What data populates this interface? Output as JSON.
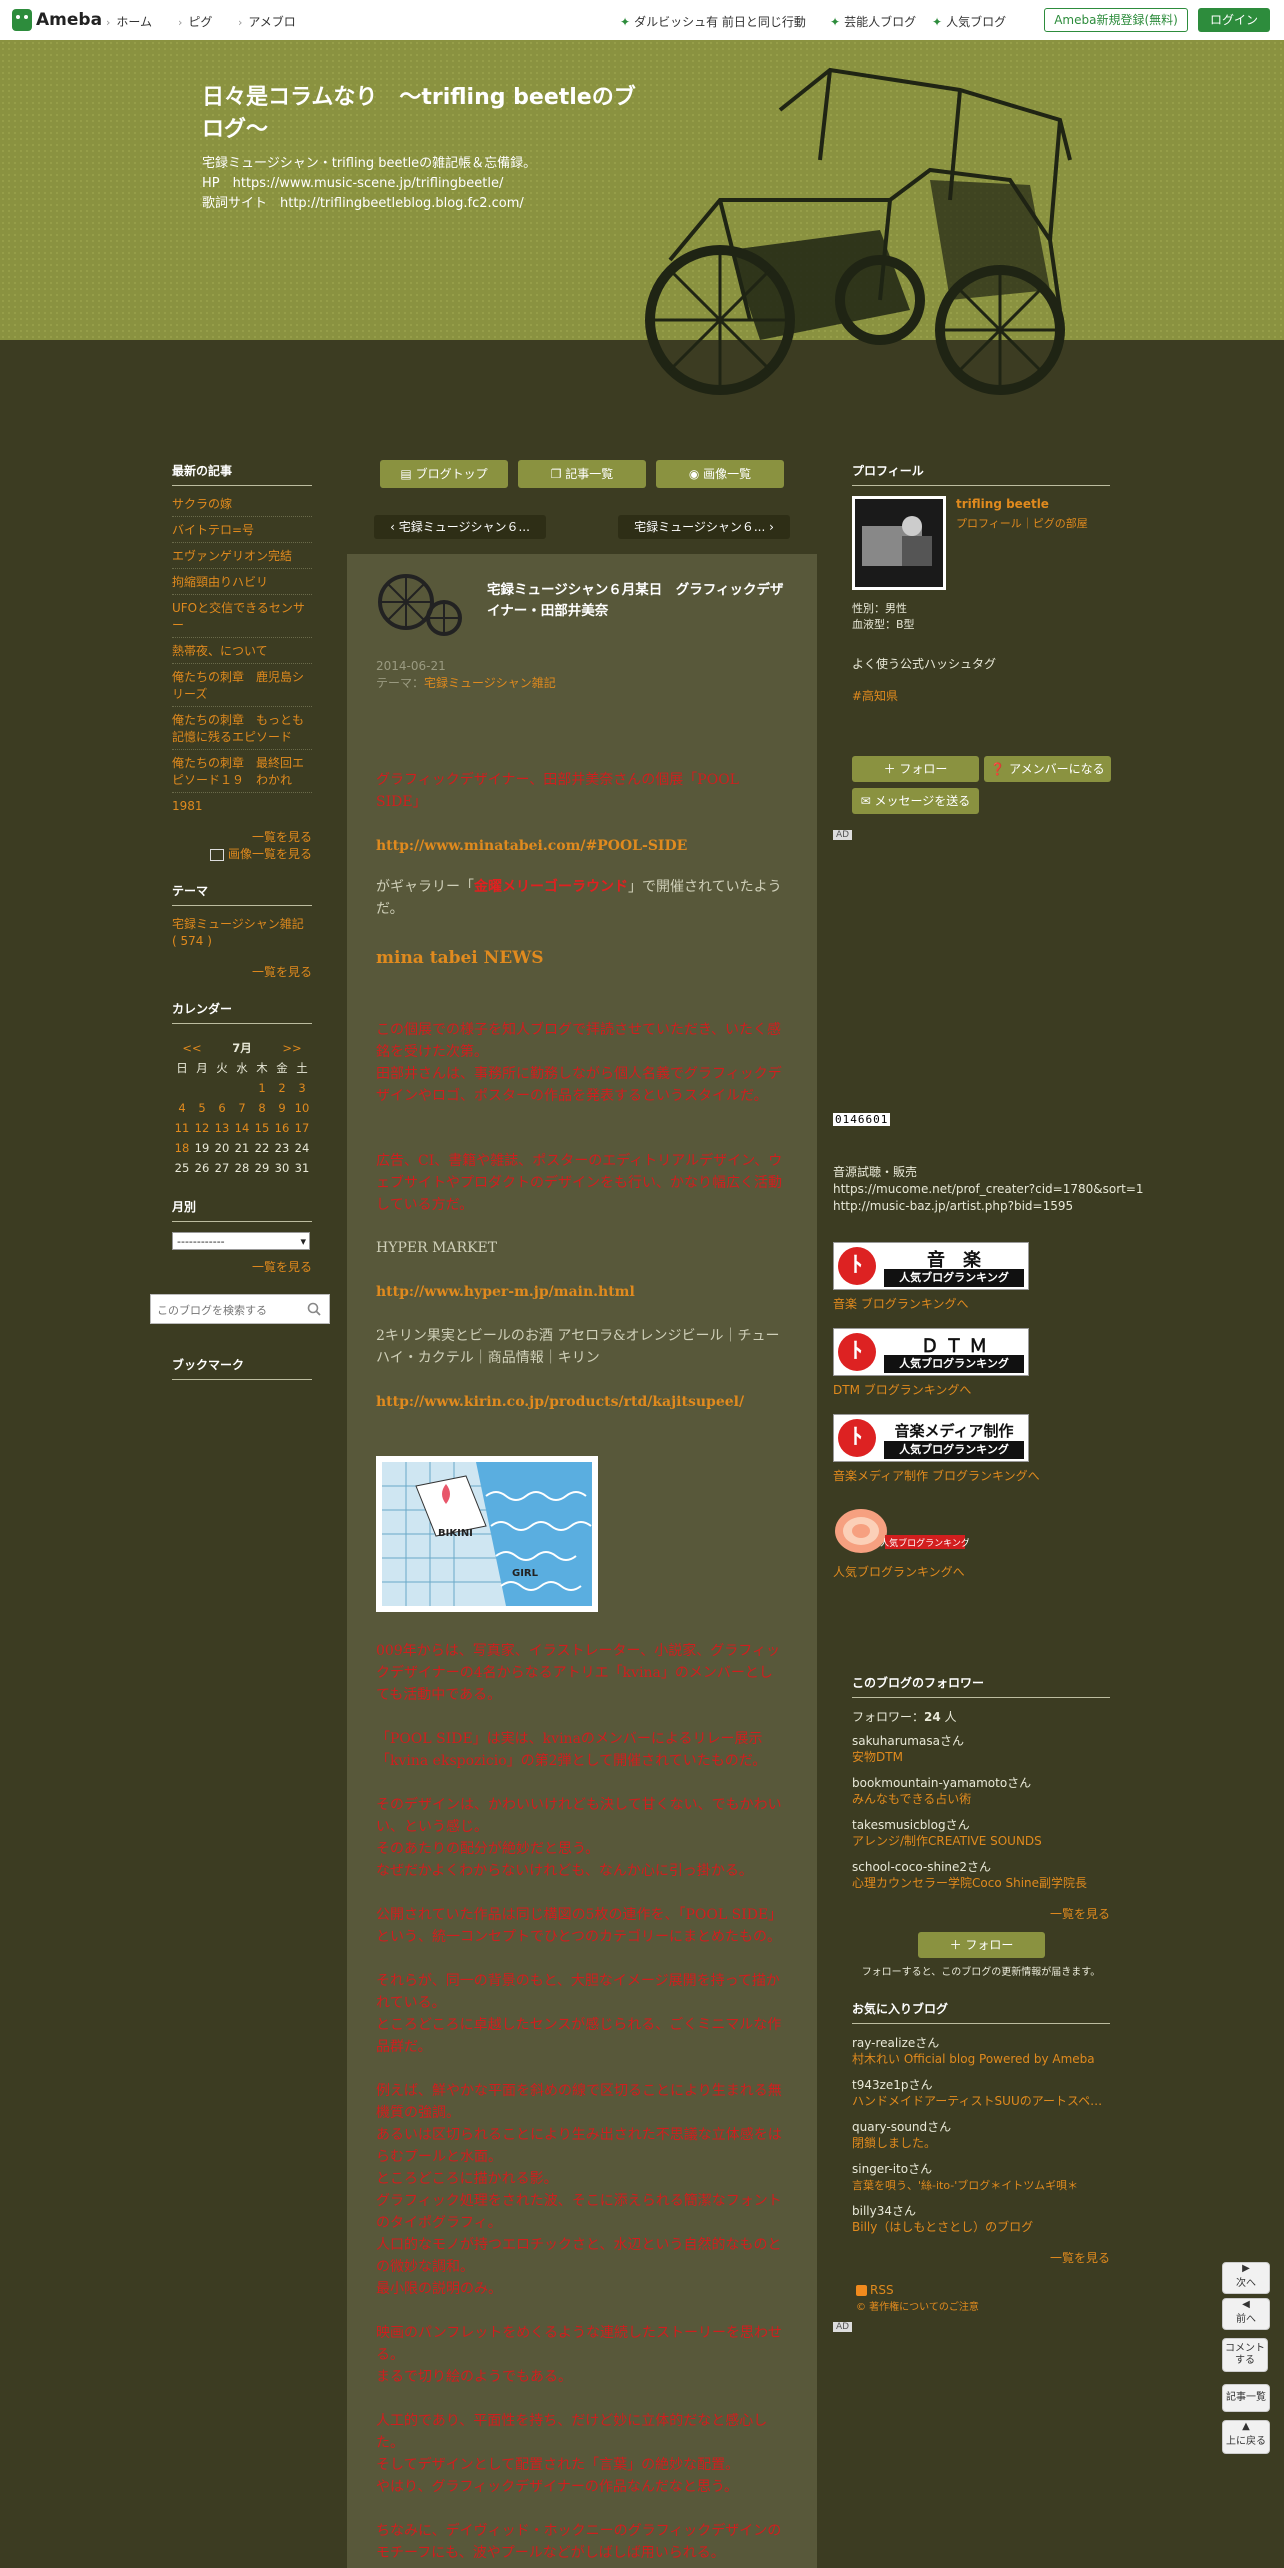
{
  "topbar": {
    "logo": "Ameba",
    "nav": [
      "ホーム",
      "ピグ",
      "アメブロ"
    ],
    "right_links": [
      "ダルビッシュ有 前日と同じ行動",
      "芸能人ブログ",
      "人気ブログ"
    ],
    "register": "Ameba新規登録(無料)",
    "login": "ログイン"
  },
  "header": {
    "title": "日々是コラムなり　～trifling beetleのブログ～",
    "desc": [
      "宅録ミュージシャン・trifling beetleの雑記帳＆忘備録。",
      "HP　https://www.music-scene.jp/triflingbeetle/",
      "歌詞サイト　http://triflingbeetleblog.blog.fc2.com/"
    ]
  },
  "left": {
    "recent_heading": "最新の記事",
    "recent": [
      "サクラの嫁",
      "バイトテロ=号",
      "エヴァンゲリオン完結",
      "拘縮頸由りハビリ",
      "UFOと交信できるセンサー",
      "熱帯夜、について",
      "俺たちの刺章　鹿児島シリーズ",
      "俺たちの刺章　もっとも記憶に残るエピソード",
      "俺たちの刺章　最終回エピソード１９　わかれ",
      "1981"
    ],
    "see_all": "一覧を見る",
    "image_list": "画像一覧を見る",
    "theme_heading": "テーマ",
    "theme": "宅録ミュージシャン雑記 ( 574 )",
    "theme_see_all": "一覧を見る",
    "calendar_heading": "カレンダー",
    "calendar": {
      "prev": "<<",
      "month": "7月",
      "next": ">>",
      "days": [
        "日",
        "月",
        "火",
        "水",
        "木",
        "金",
        "土"
      ],
      "rows": [
        [
          "",
          "",
          "",
          "",
          "",
          "1",
          "2",
          "3"
        ],
        [
          "4",
          "5",
          "6",
          "7",
          "8",
          "9",
          "10"
        ],
        [
          "11",
          "12",
          "13",
          "14",
          "15",
          "16",
          "17"
        ],
        [
          "18",
          "19",
          "20",
          "21",
          "22",
          "23",
          "24"
        ],
        [
          "25",
          "26",
          "27",
          "28",
          "29",
          "30",
          "31"
        ]
      ]
    },
    "month_heading": "月別",
    "month_select": "------------",
    "month_see_all": "一覧を見る",
    "search_placeholder": "このブログを検索する",
    "bookmark_heading": "ブックマーク"
  },
  "main": {
    "buttons": [
      "ブログトップ",
      "記事一覧",
      "画像一覧"
    ],
    "prev_post": "宅録ミュージシャン６...",
    "next_post": "宅録ミュージシャン６...",
    "title": "宅録ミュージシャン６月某日　グラフィックデザイナー・田部井美奈",
    "date": "2014-06-21",
    "theme_label": "テーマ：",
    "theme": "宅録ミュージシャン雑記",
    "p1": "グラフィックデザイナー、田部井美奈さんの個展「POOL SIDE」",
    "link1": "http://www.minatabei.com/#POOL-SIDE",
    "p2a": "がギャラリー「",
    "p2link": "金曜メリーゴーラウンド",
    "p2b": "」で開催されていたようだ。",
    "news": "mina tabei NEWS",
    "p3": [
      "この個展での様子を知人ブログで拝読させていただき、いたく感銘を受けた次第。",
      "田部井さんは、事務所に勤務しながら個人名義でグラフィックデザインやロゴ、ポスターの作品を発表するというスタイルだ。"
    ],
    "p4": "広告、CI、書籍や雑誌、ポスターのエディトリアルデザイン、ウェブサイトやプロダクトのデザインをも行い、かなり幅広く活動している方だ。",
    "hyper": "HYPER MARKET",
    "link2": "http://www.hyper-m.jp/main.html",
    "kirin": "2キリン果実とビールのお酒 アセロラ&オレンジビール｜チューハイ・カクテル｜商品情報｜キリン",
    "link3": "http://www.kirin.co.jp/products/rtd/kajitsupeel/",
    "img_text1": "BIKINI",
    "img_text2": "GIRL",
    "p5": "009年からは、写真家、イラストレーター、小説家、グラフィックデザイナーの4名からなるアトリエ「kvina」のメンバーとしても活動中である。",
    "p6": "「POOL SIDE」は実は、kvinaのメンバーによるリレー展示「kvina ekspozicio」の第2弾として開催されていたものだ。",
    "p7": [
      "そのデザインは、かわいいけれども決して甘くない、でもかわいい、という感じ。",
      "そのあたりの配分が絶妙だと思う。",
      "なぜだかよくわからないけれども、なんか心に引っ掛かる。"
    ],
    "p8": [
      "公開されていた作品は同じ構図の5枚の連作を、「POOL SIDE」という、統一コンセプトでひとつのカテゴリーにまとめたもの。",
      "それらが、同一の背景のもと、大胆なイメージ展開を持って描かれている。",
      "ところどころに卓越したセンスが感じられる、ごくミニマルな作品群だ。"
    ],
    "p9": [
      "例えば、鮮やかな平面を斜めの線で区切ることにより生まれる無機質の強調。",
      "あるいは区切られることにより生み出された不思議な立体感をはらむプールと水面。",
      "ところどころに描かれる影。",
      "グラフィック処理をされた波、そこに添えられる簡潔なフォントのタイポグラフィ。",
      "人口的なモノが持つエロチックさと、水辺という自然的なものとの微妙な調和。",
      "最小限の説明のみ。"
    ],
    "p10": [
      "映画のパンフレットをめくるような連続したストーリーを思わせる。",
      "まるで切り絵のようでもある。"
    ],
    "p11": [
      "人工的であり、平面性を持ち、だけど妙に立体的だなと感心した。",
      "そしてデザインとして配置された「言葉」の絶妙な配置。",
      "やはり、グラフィックデザイナーの作品なんだなと思う。"
    ],
    "p12": "ちなみに、デイヴィッド・ホックニーのグラフィックデザインのモチーフにも、波やプールなどがしばしば用いられる。"
  },
  "right": {
    "profile_heading": "プロフィール",
    "name": "trifling beetle",
    "profile_links": "プロフィール｜ピグの部屋",
    "gender": "性別：男性",
    "blood": "血液型：B型",
    "hashtag_heading": "よく使う公式ハッシュタグ",
    "hashtag": "#高知県",
    "follow": "フォロー",
    "member": "アメンバーになる",
    "message": "メッセージを送る",
    "ad": "AD",
    "counter": "0146601",
    "music_text": [
      "音源試聴・販売",
      "https://mucome.net/prof_creater?cid=1780&sort=1",
      "http://music-baz.jp/artist.php?bid=1595"
    ],
    "rank1_big": "音　楽",
    "rank1_small": "人気ブログランキング",
    "rank1_link": "音楽 ブログランキングへ",
    "rank2_big": "Ｄ Ｔ Ｍ",
    "rank2_small": "人気ブログランキング",
    "rank2_link": "DTM ブログランキングへ",
    "rank3_big": "音楽メディア制作",
    "rank3_small": "人気ブログランキング",
    "rank3_link": "音楽メディア制作 ブログランキングへ",
    "rank4_label": "人気ブログランキング",
    "rank4_link": "人気ブログランキングへ",
    "followers_heading": "このブログのフォロワー",
    "followers_label": "フォロワー：",
    "followers_count": "24",
    "followers_unit": "人",
    "followers": [
      {
        "name": "sakuharumasaさん",
        "blog": "安物DTM"
      },
      {
        "name": "bookmountain-yamamotoさん",
        "blog": "みんなもできる占い術"
      },
      {
        "name": "takesmusicblogさん",
        "blog": "アレンジ/制作CREATIVE SOUNDS"
      },
      {
        "name": "school-coco-shine2さん",
        "blog": "心理カウンセラー学院Coco Shine副学院長"
      }
    ],
    "followers_see_all": "一覧を見る",
    "follow2": "フォロー",
    "follow_note": "フォローすると、このブログの更新情報が届きます。",
    "fav_heading": "お気に入りブログ",
    "favs": [
      {
        "name": "ray-realizeさん",
        "blog": "村木れい Official blog Powered by Ameba"
      },
      {
        "name": "t943ze1pさん",
        "blog": "ハンドメイドアーティストSUUのアートスペ…"
      },
      {
        "name": "quary-soundさん",
        "blog": "閉鎖しました。"
      },
      {
        "name": "singer-itoさん",
        "blog": "言葉を唄う、'絲-ito-'ブログ＊イトツムギ唄＊"
      },
      {
        "name": "billy34さん",
        "blog": "Billy（はしもとさとし）のブログ"
      }
    ],
    "fav_see_all": "一覧を見る",
    "rss": "RSS",
    "copyright": "© 著作権についてのご注意",
    "ad2": "AD"
  },
  "side_tools": [
    "次へ",
    "前へ",
    "コメントする",
    "記事一覧",
    "上に戻る"
  ]
}
